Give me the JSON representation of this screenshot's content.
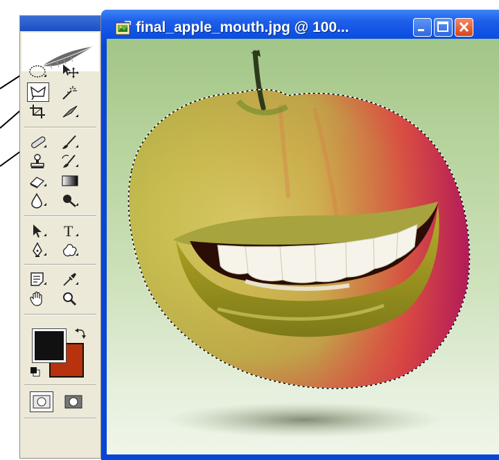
{
  "document": {
    "title": "final_apple_mouth.jpg @ 100..."
  },
  "toolbox": {
    "foreground_color": "#111111",
    "background_color": "#b8320e"
  },
  "colors": {
    "titlebar": "#0a46d6",
    "close_button": "#e0502a"
  },
  "icons": {
    "document": "jpeg-file-icon",
    "minimize": "minimize-icon",
    "maximize": "maximize-icon",
    "close": "close-icon"
  }
}
